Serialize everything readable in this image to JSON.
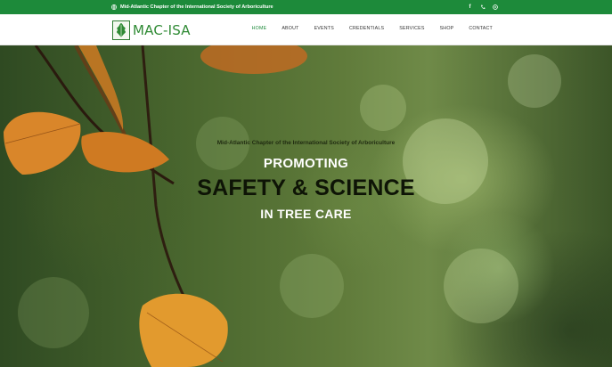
{
  "topbar": {
    "tagline": "Mid-Atlantic Chapter of the International Society of Arboriculture",
    "icons": [
      "globe-icon",
      "facebook-icon",
      "phone-icon",
      "email-icon"
    ],
    "color": "#1d8a3a"
  },
  "header": {
    "logo_text": "MAC-ISA",
    "nav": [
      {
        "label": "HOME",
        "active": true
      },
      {
        "label": "ABOUT",
        "active": false
      },
      {
        "label": "EVENTS",
        "active": false
      },
      {
        "label": "CREDENTIALS",
        "active": false
      },
      {
        "label": "SERVICES",
        "active": false
      },
      {
        "label": "SHOP",
        "active": false
      },
      {
        "label": "CONTACT",
        "active": false
      }
    ]
  },
  "hero": {
    "subtitle": "Mid-Atlantic Chapter of the International Society of Arboriculture",
    "line1": "PROMOTING",
    "line2": "SAFETY & SCIENCE",
    "line3": "IN TREE CARE"
  }
}
